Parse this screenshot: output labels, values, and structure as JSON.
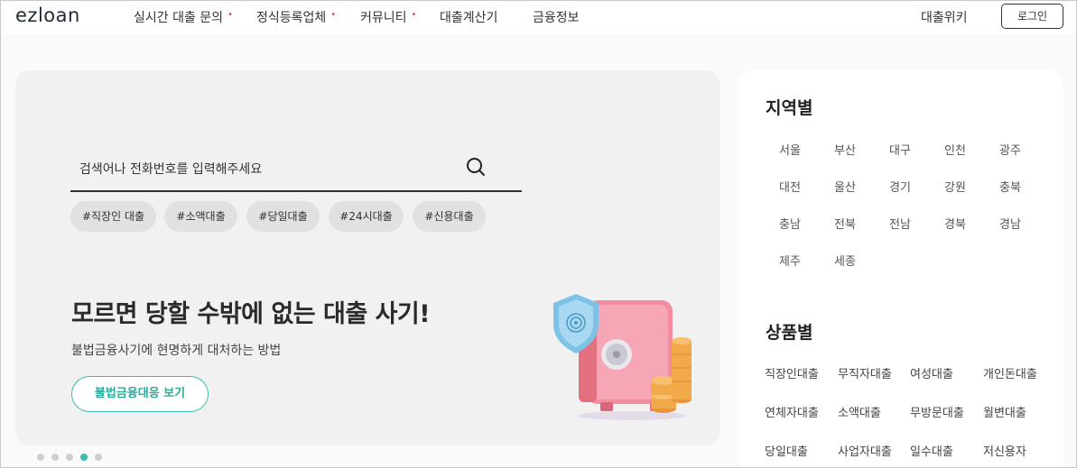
{
  "header": {
    "logo": "ezloan",
    "nav": [
      {
        "label": "실시간 대출 문의",
        "dot": "•"
      },
      {
        "label": "정식등록업체",
        "dot": "•"
      },
      {
        "label": "커뮤니티",
        "dot": "•"
      },
      {
        "label": "대출계산기",
        "dot": ""
      },
      {
        "label": "금융정보",
        "dot": ""
      }
    ],
    "util_link": "대출위키",
    "login": "로그인"
  },
  "banner": {
    "search_placeholder": "검색어나 전화번호를 입력해주세요",
    "tags": [
      "#직장인 대출",
      "#소액대출",
      "#당일대출",
      "#24시대출",
      "#신용대출"
    ],
    "headline": "모르면 당할 수밖에 없는 대출 사기!",
    "subline": "불법금융사기에 현명하게 대처하는 방법",
    "cta": "불법금융대응 보기",
    "slides_total": 5,
    "slide_active": 4
  },
  "side": {
    "region_title": "지역별",
    "regions": [
      "서울",
      "부산",
      "대구",
      "인천",
      "광주",
      "대전",
      "울산",
      "경기",
      "강원",
      "충북",
      "충남",
      "전북",
      "전남",
      "경북",
      "경남",
      "제주",
      "세종"
    ],
    "product_title": "상품별",
    "products": [
      "직장인대출",
      "무직자대출",
      "여성대출",
      "개인돈대출",
      "연체자대출",
      "소액대출",
      "무방문대출",
      "월변대출",
      "당일대출",
      "사업자대출",
      "일수대출",
      "저신용자"
    ]
  },
  "colors": {
    "accent": "#3cbfae",
    "nav_dot": "#e5484d"
  },
  "icons": {
    "search": "search-icon",
    "illustration": "safe-shield-coins-illustration"
  }
}
